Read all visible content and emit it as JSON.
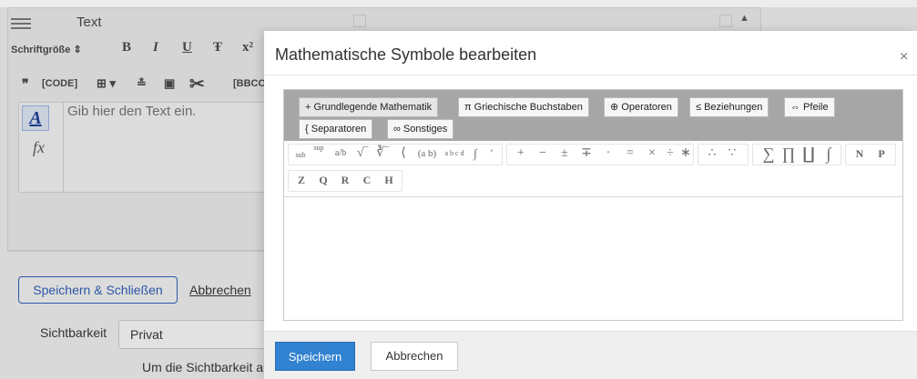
{
  "background": {
    "section_title": "Text",
    "toolbar": {
      "font_size": "Schriftgröße",
      "bold": "B",
      "italic": "I",
      "underline": "U",
      "strike": "Ŧ",
      "superscript": "x²",
      "quote": "❞",
      "code": "[CODE]",
      "bbcode": "[BBCO"
    },
    "editor_placeholder": "Gib hier den Text ein.",
    "formula_icon": "fx",
    "save_close_label": "Speichern & Schließen",
    "cancel_label": "Abbrechen",
    "visibility_label": "Sichtbarkeit",
    "visibility_value": "Privat",
    "visibility_hint": "Um die Sichtbarkeit auf '"
  },
  "dialog": {
    "title": "Mathematische Symbole bearbeiten",
    "close": "×",
    "tabs": [
      "+ Grundlegende Mathematik",
      "π Griechische Buchstaben",
      "⊕ Operatoren",
      "≤ Beziehungen",
      "⇔ Pfeile",
      "{ Separatoren",
      "∞ Sonstiges"
    ],
    "symbols_row1": [
      "sub",
      "sup",
      "a/b",
      "√‾",
      "∛‾",
      "⟨",
      "(a b)",
      "a b c d",
      "∫",
      "′",
      "+",
      "−",
      "±",
      "∓",
      "·",
      "=",
      "×",
      "÷",
      "∗",
      "∴",
      "∵",
      "∑",
      "∏",
      "∐",
      "∫",
      "N",
      "P"
    ],
    "symbols_row2": [
      "Z",
      "Q",
      "R",
      "C",
      "H"
    ],
    "save_label": "Speichern",
    "cancel_label": "Abbrechen"
  },
  "colors": {
    "primary": "#3182d0",
    "tab_bar": "#a6a6a6",
    "overlay": "#d9d9d9"
  }
}
